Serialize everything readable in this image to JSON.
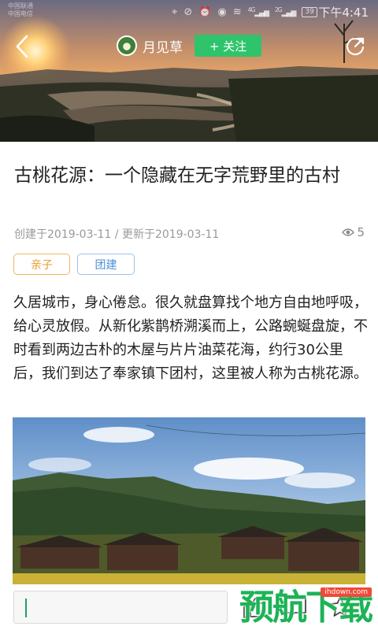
{
  "status_bar": {
    "carrier_1": "中国联通",
    "carrier_2": "中国电信",
    "signal_1": "4G",
    "signal_2": "2G",
    "battery": "39",
    "time": "下午4:41"
  },
  "header": {
    "author_name": "月见草",
    "follow_label": "+ 关注"
  },
  "article": {
    "title": "古桃花源：一个隐藏在无字荒野里的古村",
    "meta": "创建于2019-03-11 / 更新于2019-03-11",
    "view_count": "5",
    "tags": [
      "亲子",
      "团建"
    ],
    "paragraph": "久居城市，身心倦怠。很久就盘算找个地方自由地呼吸，给心灵放假。从新化紫鹊桥溯溪而上，公路蜿蜒盘旋，不时看到两边古朴的木屋与片片油菜花海，约行30公里后，我们到达了奉家镇下团村，这里被人称为古桃花源。"
  },
  "watermark": {
    "text": "预航下载",
    "url": "ihdown.com"
  },
  "icons": {
    "back": "chevron-left-icon",
    "share": "share-icon",
    "views": "eye-icon",
    "like": "thumb-up-icon",
    "comment": "comment-icon",
    "favorite": "star-icon"
  },
  "colors": {
    "follow_green": "#2fc46b",
    "tag_orange": "#e99a2f",
    "tag_blue": "#4c8fd6",
    "watermark_green": "#1db357"
  }
}
